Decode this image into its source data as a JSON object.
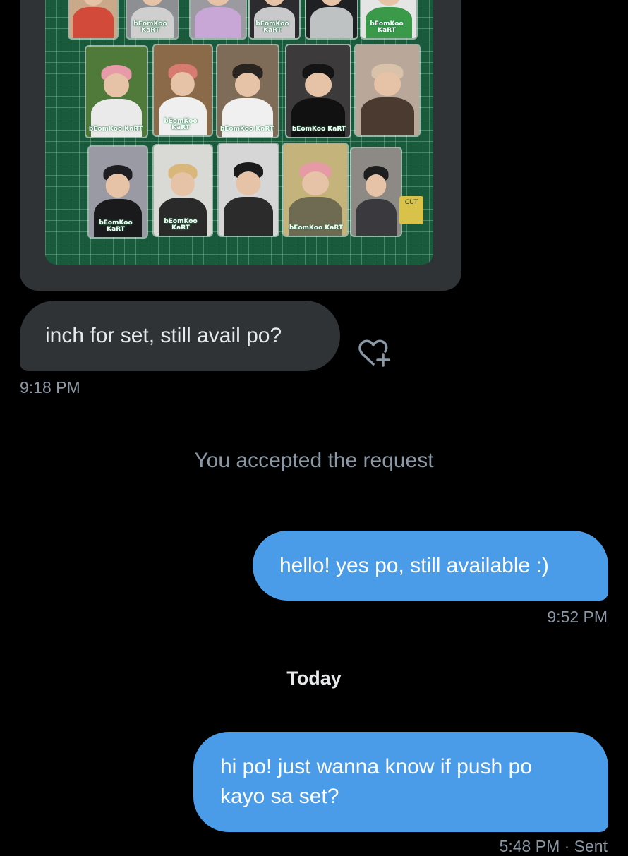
{
  "conversation": {
    "attachment": {
      "type": "photo",
      "stamp_text": "bEomKoo KaRT",
      "cut_label": "CUT"
    },
    "messages": [
      {
        "direction": "incoming",
        "text": "inch for set, still avail po?",
        "time": "9:18 PM"
      },
      {
        "direction": "outgoing",
        "text": "hello! yes po, still available :)",
        "time": "9:52 PM"
      },
      {
        "direction": "outgoing",
        "text": "hi po! just wanna know if push po kayo sa set?",
        "time": "5:48 PM · Sent"
      }
    ],
    "system_message": "You accepted the request",
    "day_divider": "Today"
  },
  "icons": {
    "react": "heart-plus-icon"
  },
  "colors": {
    "background": "#000000",
    "incoming_bubble": "#2f3336",
    "outgoing_bubble": "#4a9ce9",
    "secondary_text": "#8b98a5"
  }
}
